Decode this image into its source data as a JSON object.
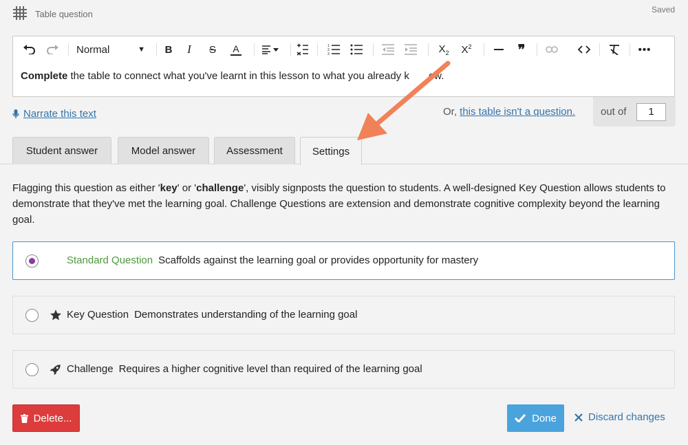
{
  "header": {
    "title": "Table question",
    "status": "Saved",
    "icon": "table-grid-icon"
  },
  "toolbar": {
    "format_value": "Normal",
    "buttons": [
      "undo",
      "redo",
      "bold",
      "italic",
      "strikethrough",
      "text-color",
      "align",
      "line-height",
      "ordered-list",
      "bullet-list",
      "outdent",
      "indent",
      "subscript",
      "superscript",
      "horizontal-rule",
      "blockquote",
      "link",
      "code",
      "clear-format",
      "more"
    ]
  },
  "editor": {
    "bold_word": "Complete",
    "text_before_arrow": " the table to connect what you've learnt in this lesson to what you already k",
    "text_after_arrow": "ew."
  },
  "narrate": {
    "label": "Narrate this text"
  },
  "question_toggle": {
    "prefix": "Or, ",
    "link": "this table isn't a question."
  },
  "score": {
    "label": "out of",
    "value": "1"
  },
  "tabs": [
    {
      "label": "Student answer"
    },
    {
      "label": "Model answer"
    },
    {
      "label": "Assessment"
    },
    {
      "label": "Settings",
      "active": true
    }
  ],
  "description": {
    "p1": "Flagging this question as either '",
    "key": "key",
    "p2": "' or '",
    "challenge": "challenge",
    "p3": "', visibly signposts the question to students. A well-designed Key Question allows students to demonstrate that they've met the learning goal. Challenge Questions are extension and demonstrate cognitive complexity beyond the learning goal."
  },
  "options": [
    {
      "title": "Standard Question",
      "desc": "Scaffolds against the learning goal or provides opportunity for mastery",
      "selected": true
    },
    {
      "title": "Key Question",
      "desc": "Demonstrates understanding of the learning goal",
      "icon": "star-icon"
    },
    {
      "title": "Challenge",
      "desc": "Requires a higher cognitive level than required of the learning goal",
      "icon": "rocket-icon"
    }
  ],
  "actions": {
    "delete": "Delete...",
    "done": "Done",
    "discard": "Discard changes"
  },
  "colors": {
    "accent": "#4aa3dc",
    "danger": "#dc3c3c",
    "link": "#3374a9",
    "standard_green": "#4c9a3d",
    "radio_purple": "#8b3ea0",
    "arrow": "#f08158"
  }
}
